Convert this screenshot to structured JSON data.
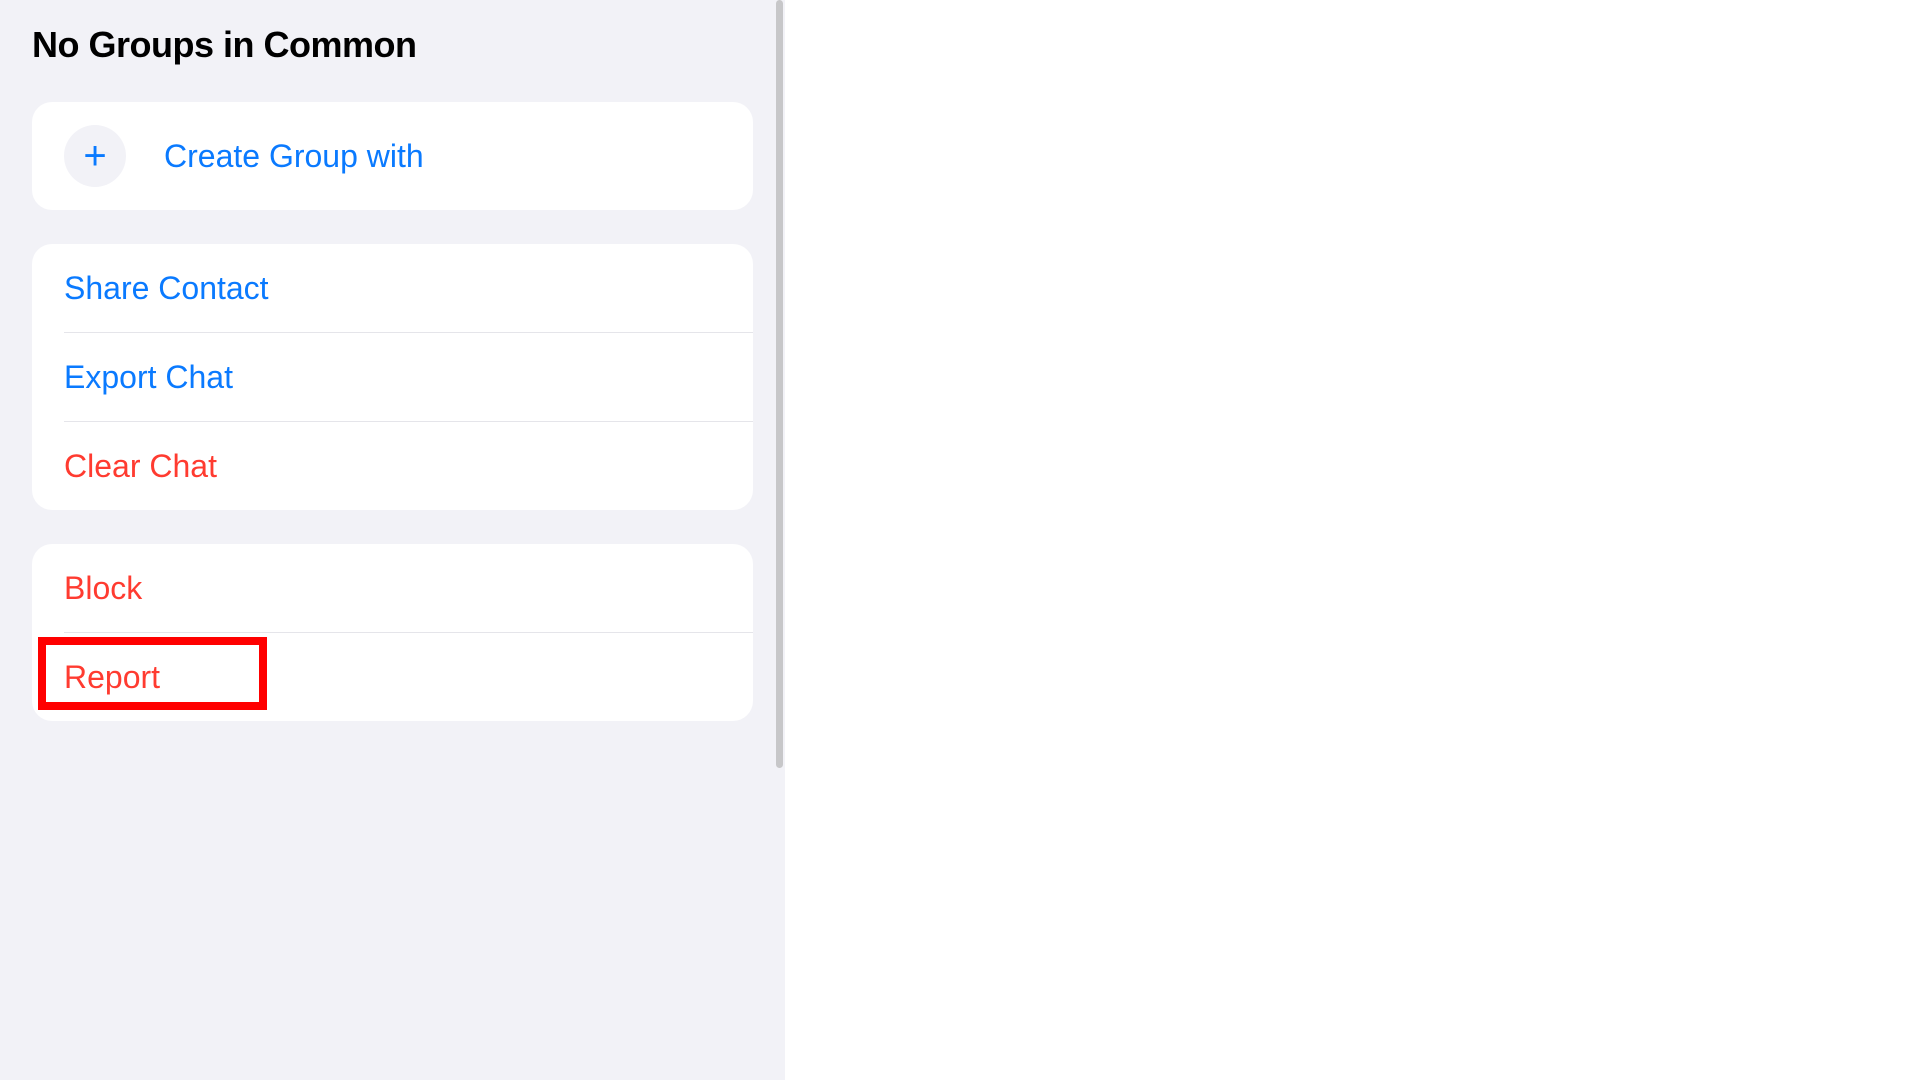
{
  "section": {
    "title": "No Groups in Common"
  },
  "group1": {
    "create_group": "Create Group with"
  },
  "group2": {
    "share_contact": "Share Contact",
    "export_chat": "Export Chat",
    "clear_chat": "Clear Chat"
  },
  "group3": {
    "block": "Block",
    "report": "Report"
  },
  "colors": {
    "blue": "#0a7aff",
    "red": "#ff3b30",
    "bg_grey": "#f2f2f7"
  },
  "highlight": {
    "target": "report-item"
  }
}
